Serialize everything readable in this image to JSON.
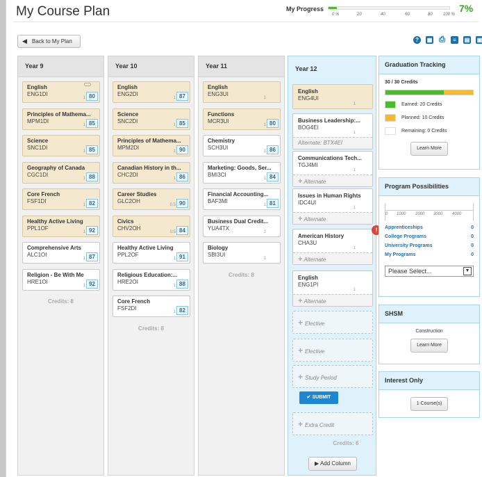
{
  "header": {
    "title": "My Course Plan"
  },
  "progress": {
    "label": "My Progress",
    "value_pct": 7,
    "percent_text": "7%",
    "ticks": [
      "0 %",
      "20",
      "40",
      "60",
      "80",
      "100 %"
    ]
  },
  "toolbar": {
    "back_label": "Back to My Plan",
    "icons": [
      "help-icon",
      "calculator-icon",
      "print-icon",
      "document-icon",
      "report-icon",
      "briefcase-icon"
    ]
  },
  "years": [
    {
      "label": "Year 9",
      "credits": "Credits: 8",
      "courses": [
        {
          "name": "English",
          "code": "ENG1DI",
          "credit": "1",
          "grade": "80",
          "style": "beige",
          "glasses": true
        },
        {
          "name": "Principles of Mathema...",
          "code": "MPM1DI",
          "credit": "1",
          "grade": "85",
          "style": "beige"
        },
        {
          "name": "Science",
          "code": "SNC1DI",
          "credit": "1",
          "grade": "85",
          "style": "beige"
        },
        {
          "name": "Geography of Canada",
          "code": "CGC1DI",
          "credit": "1",
          "grade": "88",
          "style": "beige"
        },
        {
          "name": "Core French",
          "code": "FSF1DI",
          "credit": "1",
          "grade": "82",
          "style": "beige"
        },
        {
          "name": "Healthy Active Living",
          "code": "PPL1OF",
          "credit": "1",
          "grade": "92",
          "style": "beige"
        },
        {
          "name": "Comprehensive Arts",
          "code": "ALC1OI",
          "credit": "1",
          "grade": "87",
          "style": "white"
        },
        {
          "name": "Religion - Be With Me",
          "code": "HRE1OI",
          "credit": "1",
          "grade": "92",
          "style": "white"
        }
      ]
    },
    {
      "label": "Year 10",
      "credits": "Credits: 8",
      "courses": [
        {
          "name": "English",
          "code": "ENG2DI",
          "credit": "1",
          "grade": "87",
          "style": "beige"
        },
        {
          "name": "Science",
          "code": "SNC2DI",
          "credit": "1",
          "grade": "85",
          "style": "beige"
        },
        {
          "name": "Principles of Mathema...",
          "code": "MPM2DI",
          "credit": "1",
          "grade": "90",
          "style": "beige"
        },
        {
          "name": "Canadian History in th...",
          "code": "CHC2DI",
          "credit": "1",
          "grade": "86",
          "style": "beige"
        },
        {
          "name": "Career Studies",
          "code": "GLC2OH",
          "credit": "0.5",
          "grade": "90",
          "style": "beige"
        },
        {
          "name": "Civics",
          "code": "CHV2OH",
          "credit": "0.5",
          "grade": "84",
          "style": "beige"
        },
        {
          "name": "Healthy Active Living",
          "code": "PPL2OF",
          "credit": "1",
          "grade": "91",
          "style": "white"
        },
        {
          "name": "Religious Education:...",
          "code": "HRE2OI",
          "credit": "1",
          "grade": "88",
          "style": "white"
        },
        {
          "name": "Core French",
          "code": "FSF2DI",
          "credit": "1",
          "grade": "82",
          "style": "white"
        }
      ]
    },
    {
      "label": "Year 11",
      "credits": "Credits: 8",
      "courses": [
        {
          "name": "English",
          "code": "ENG3UI",
          "credit": "1",
          "grade": "",
          "style": "beige"
        },
        {
          "name": "Functions",
          "code": "MCR3UI",
          "credit": "1",
          "grade": "80",
          "style": "beige"
        },
        {
          "name": "Chemistry",
          "code": "SCH3UI",
          "credit": "1",
          "grade": "86",
          "style": "white"
        },
        {
          "name": "Marketing: Goods, Ser...",
          "code": "BMI3CI",
          "credit": "1",
          "grade": "84",
          "style": "white"
        },
        {
          "name": "Financial Accounting...",
          "code": "BAF3MI",
          "credit": "1",
          "grade": "81",
          "style": "white"
        },
        {
          "name": "Business Dual Credit...",
          "code": "YUA4TX",
          "credit": "2",
          "grade": "",
          "style": "white"
        },
        {
          "name": "Biology",
          "code": "SBI3UI",
          "credit": "1",
          "grade": "",
          "style": "white"
        }
      ]
    }
  ],
  "year12": {
    "label": "Year 12",
    "credits": "Credits: 6",
    "courses": [
      {
        "name": "English",
        "code": "ENG4UI",
        "credit": "1",
        "style": "beige",
        "alternate": ""
      },
      {
        "name": "Business Leadership:...",
        "code": "BOG4EI",
        "credit": "1",
        "style": "white",
        "alternate": "Alternate: BTX4EI"
      },
      {
        "name": "Communications Tech...",
        "code": "TGJ4MI",
        "credit": "1",
        "style": "white",
        "alternate": "Alternate"
      },
      {
        "name": "Issues in Human Rights",
        "code": "IDC4UI",
        "credit": "1",
        "style": "white",
        "alternate": "Alternate"
      },
      {
        "name": "American History",
        "code": "CHA3U",
        "credit": "1",
        "style": "white",
        "alternate": "Alternate",
        "warning": "!"
      },
      {
        "name": "English",
        "code": "ENG1PI",
        "credit": "1",
        "style": "white",
        "alternate": "Alternate"
      }
    ],
    "slots": [
      "Elective",
      "Elective",
      "Study Period"
    ],
    "submit_label": "SUBMIT",
    "extra_slot": "Extra Credit",
    "add_column_label": "Add Column"
  },
  "graduation": {
    "title": "Graduation Tracking",
    "credits_text": "30 / 30 Credits",
    "earned_fraction": 0.67,
    "planned_fraction": 0.33,
    "legend": [
      {
        "label": "Earned: 20 Credits",
        "color": "#4bbb2b"
      },
      {
        "label": "Planned: 10 Credits",
        "color": "#f6b92b"
      },
      {
        "label": "Remaining: 0 Credits",
        "color": "#ffffff"
      }
    ],
    "learn_more": "Learn More"
  },
  "possibilities": {
    "title": "Program Possibilities",
    "scale_ticks": [
      "0",
      "1000",
      "2000",
      "3000",
      "4000"
    ],
    "rows": [
      {
        "label": "Apprenticeships",
        "value": "0"
      },
      {
        "label": "College Programs",
        "value": "0"
      },
      {
        "label": "University Programs",
        "value": "0"
      },
      {
        "label": "My Programs",
        "value": "0"
      }
    ],
    "select_value": "Please Select..."
  },
  "shsm": {
    "title": "SHSM",
    "program": "Construction",
    "learn_more": "Learn More"
  },
  "interest": {
    "title": "Interest Only",
    "button": "1 Course(s)"
  }
}
